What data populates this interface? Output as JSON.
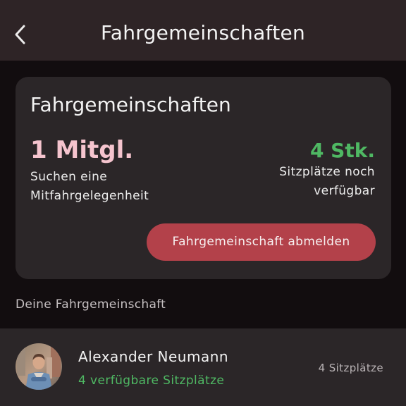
{
  "header": {
    "title": "Fahrgemeinschaften",
    "back_icon": "chevron-left-icon"
  },
  "summary_card": {
    "title": "Fahrgemeinschaften",
    "members_count": "1 Mitgl.",
    "members_desc_line1": "Suchen eine",
    "members_desc_line2": "Mitfahrgelegenheit",
    "seats_count": "4 Stk.",
    "seats_desc_line1": "Sitzplätze noch",
    "seats_desc_line2": "verfügbar",
    "leave_button": "Fahrgemeinschaft abmelden"
  },
  "section_label": "Deine Fahrgemeinschaft",
  "members": [
    {
      "name": "Alexander Neumann",
      "available": "4 verfügbare Sitzplätze",
      "seats": "4 Sitzplätze"
    }
  ],
  "colors": {
    "background": "#120d0f",
    "navbar": "#2e2426",
    "card": "#2b2628",
    "pink_accent": "#f5c4ce",
    "green_accent": "#4fb863",
    "danger_button": "#b3414a"
  }
}
